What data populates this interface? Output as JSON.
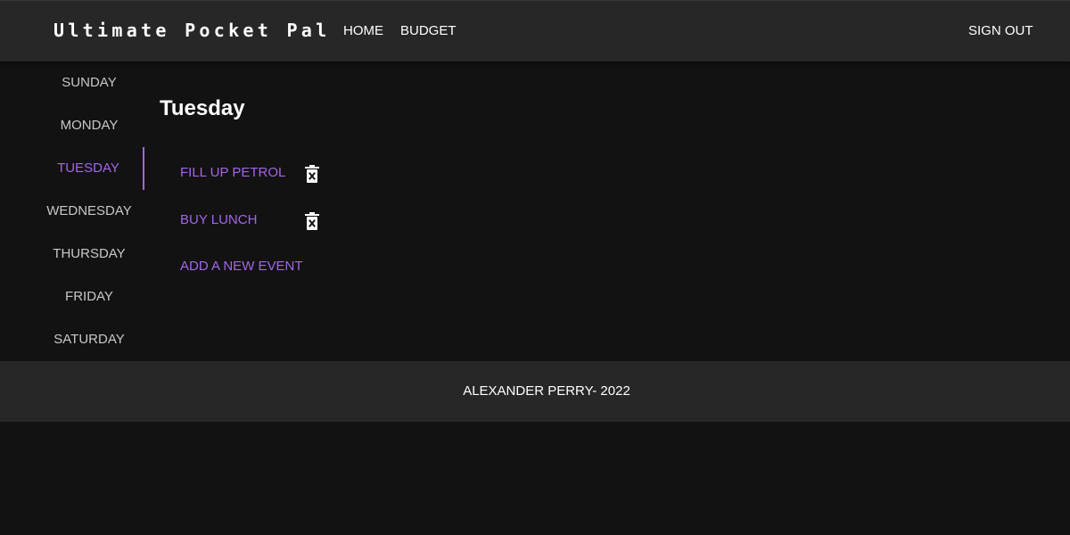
{
  "header": {
    "brand": "Ultimate Pocket Pal",
    "nav": {
      "home": "HOME",
      "budget": "BUDGET",
      "sign_out": "SIGN OUT"
    }
  },
  "sidebar": {
    "selected": "TUESDAY",
    "days": [
      "SUNDAY",
      "MONDAY",
      "TUESDAY",
      "WEDNESDAY",
      "THURSDAY",
      "FRIDAY",
      "SATURDAY"
    ]
  },
  "main": {
    "title": "Tuesday",
    "events": [
      {
        "label": "FILL UP PETROL",
        "action_icon": "trash-icon"
      },
      {
        "label": "BUY LUNCH",
        "action_icon": "trash-icon"
      }
    ],
    "add_event_label": "ADD A NEW EVENT"
  },
  "footer": {
    "text": "ALEXANDER PERRY- 2022"
  },
  "colors": {
    "background": "#121212",
    "bar": "#272727",
    "accent": "#a365e8",
    "text": "#ffffff",
    "muted_text": "#c8c8c8"
  }
}
